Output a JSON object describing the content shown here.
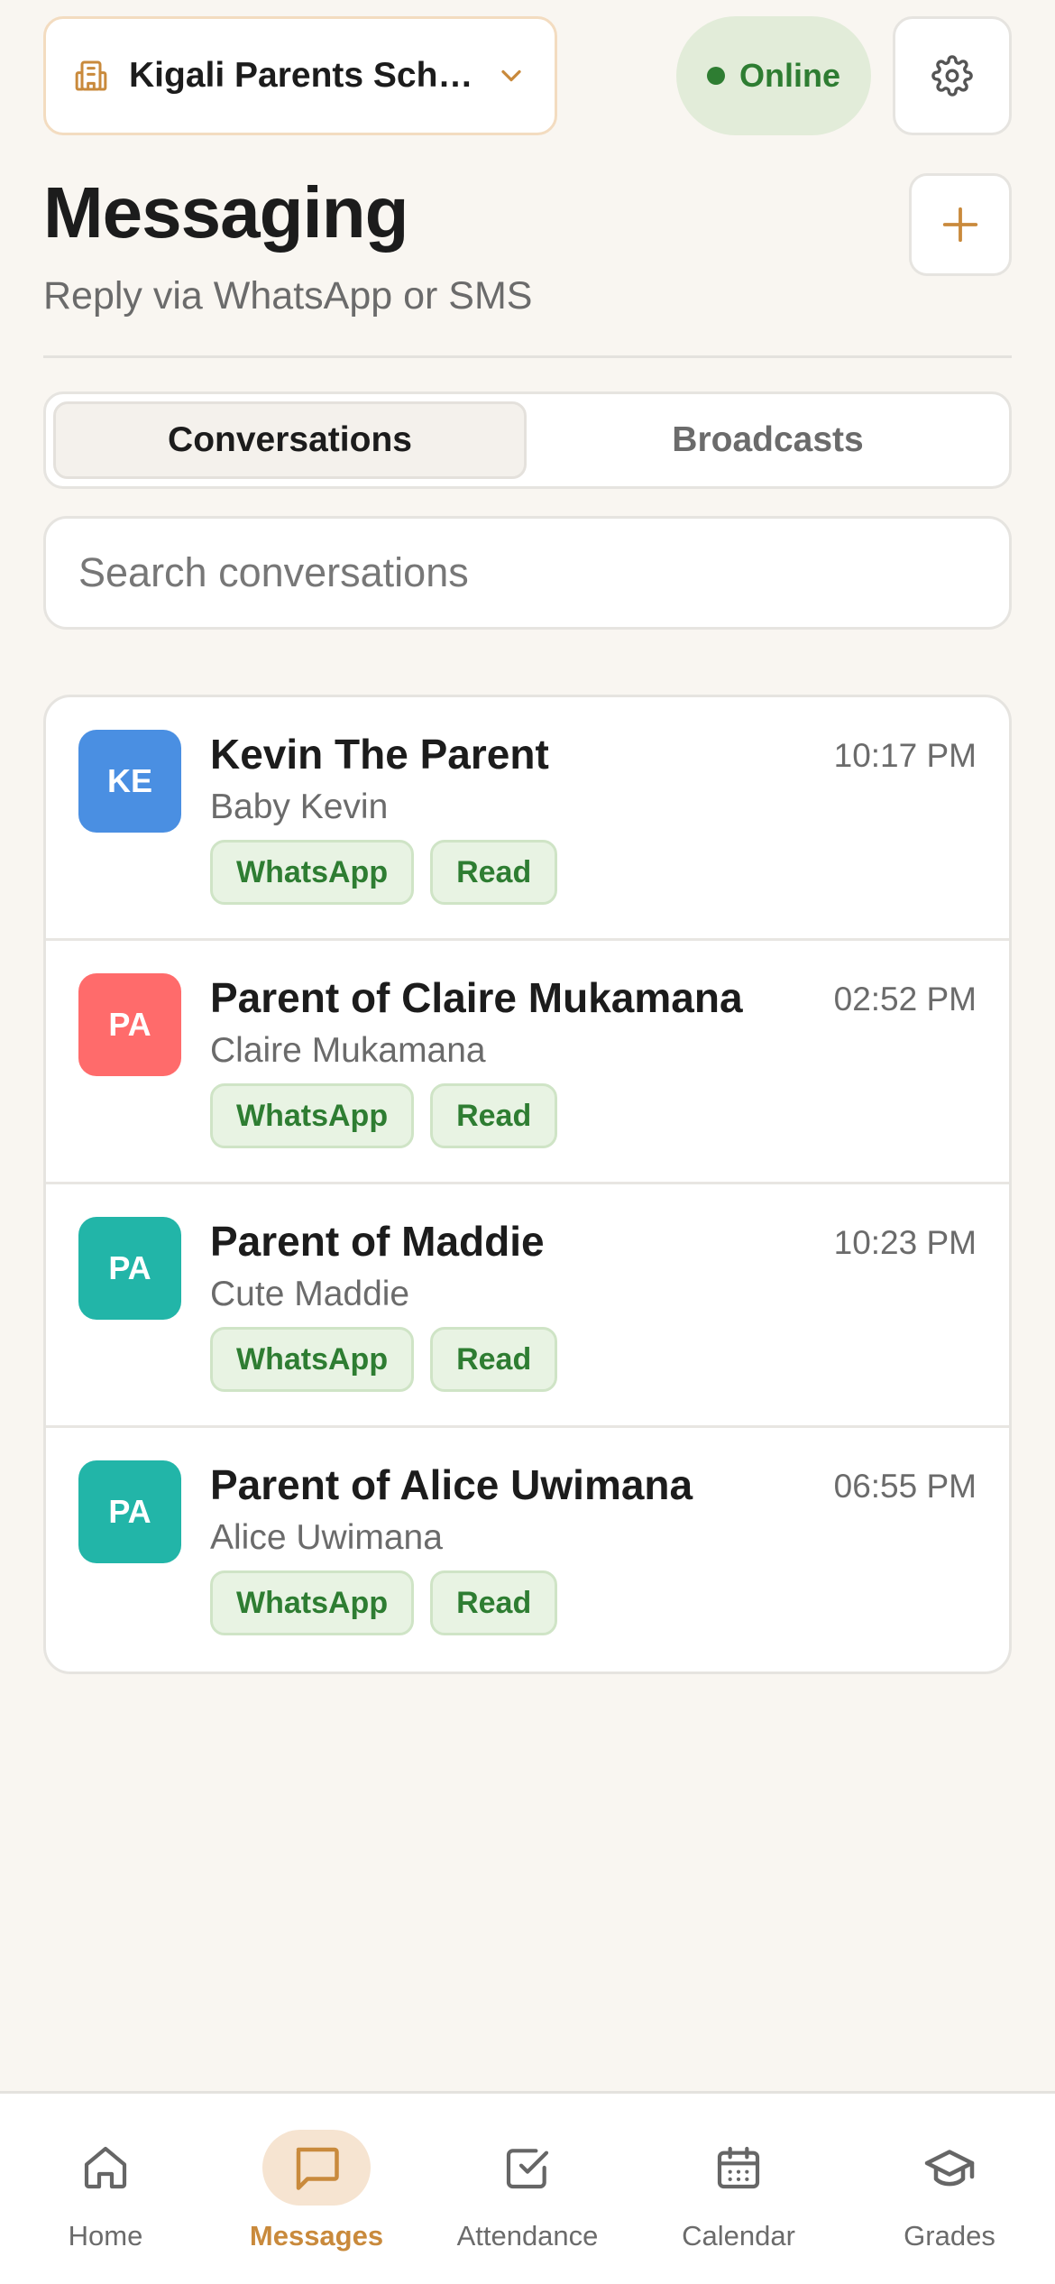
{
  "header": {
    "school_name": "Kigali Parents School",
    "status_label": "Online",
    "icons": {
      "school": "building-icon",
      "chevron": "chevron-down-icon",
      "settings": "gear-icon",
      "add": "plus-icon"
    }
  },
  "page": {
    "title": "Messaging",
    "subtitle": "Reply via WhatsApp or SMS"
  },
  "tabs": [
    {
      "label": "Conversations",
      "active": true
    },
    {
      "label": "Broadcasts",
      "active": false
    }
  ],
  "search": {
    "placeholder": "Search conversations",
    "value": ""
  },
  "conversations": [
    {
      "initials": "KE",
      "name": "Kevin The Parent",
      "child": "Baby Kevin",
      "time": "10:17 PM",
      "channel": "WhatsApp",
      "status": "Read",
      "avatar_color": "#4a8fe2"
    },
    {
      "initials": "PA",
      "name": "Parent of Claire Mukamana",
      "child": "Claire Mukamana",
      "time": "02:52 PM",
      "channel": "WhatsApp",
      "status": "Read",
      "avatar_color": "#ff6b6b"
    },
    {
      "initials": "PA",
      "name": "Parent of Maddie",
      "child": "Cute Maddie",
      "time": "10:23 PM",
      "channel": "WhatsApp",
      "status": "Read",
      "avatar_color": "#22b5a8"
    },
    {
      "initials": "PA",
      "name": "Parent of Alice Uwimana",
      "child": "Alice Uwimana",
      "time": "06:55 PM",
      "channel": "WhatsApp",
      "status": "Read",
      "avatar_color": "#22b5a8"
    }
  ],
  "nav": [
    {
      "label": "Home",
      "icon": "home-icon",
      "active": false
    },
    {
      "label": "Messages",
      "icon": "message-icon",
      "active": true
    },
    {
      "label": "Attendance",
      "icon": "checkbox-icon",
      "active": false
    },
    {
      "label": "Calendar",
      "icon": "calendar-icon",
      "active": false
    },
    {
      "label": "Grades",
      "icon": "graduation-cap-icon",
      "active": false
    }
  ],
  "colors": {
    "accent": "#c98a3c",
    "success": "#2e7d32",
    "background": "#f9f6f1"
  }
}
